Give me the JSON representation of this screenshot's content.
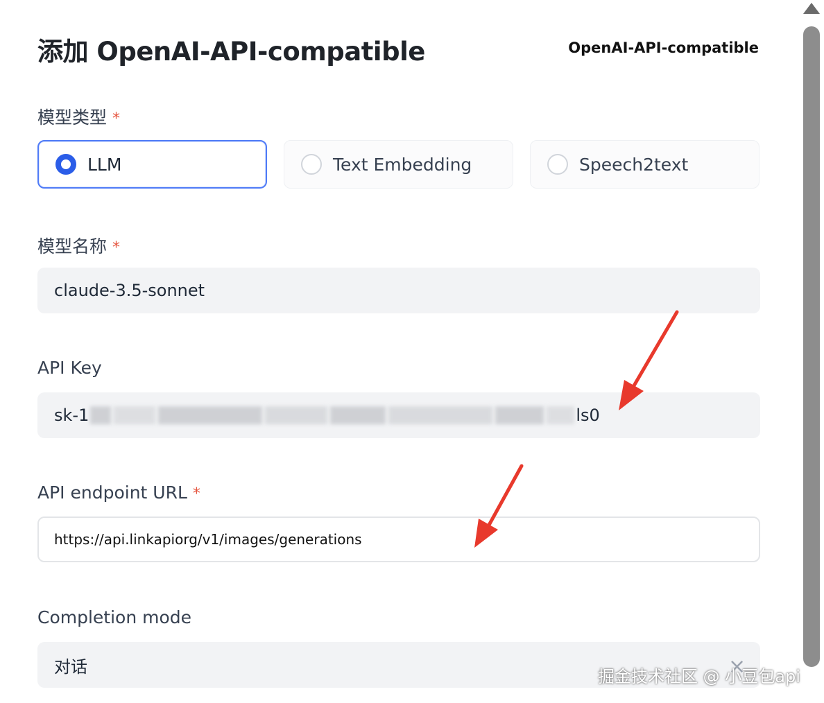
{
  "dialog": {
    "title": "添加 OpenAI-API-compatible",
    "provider_label": "OpenAI-API-compatible"
  },
  "model_type": {
    "label": "模型类型",
    "required_mark": "*",
    "options": [
      {
        "label": "LLM",
        "selected": true
      },
      {
        "label": "Text Embedding",
        "selected": false
      },
      {
        "label": "Speech2text",
        "selected": false
      }
    ]
  },
  "model_name": {
    "label": "模型名称",
    "required_mark": "*",
    "value": "claude-3.5-sonnet"
  },
  "api_key": {
    "label": "API Key",
    "value_prefix": "sk-1",
    "value_suffix": "ls0"
  },
  "endpoint": {
    "label": "API endpoint URL",
    "required_mark": "*",
    "value": "https://api.linkapiorg/v1/images/generations"
  },
  "completion_mode": {
    "label": "Completion mode",
    "value": "对话"
  },
  "watermark": "掘金技术社区 @ 小豆包api",
  "colors": {
    "accent": "#2b5de8",
    "annotation_arrow": "#e8392c",
    "required": "#e5533d"
  }
}
